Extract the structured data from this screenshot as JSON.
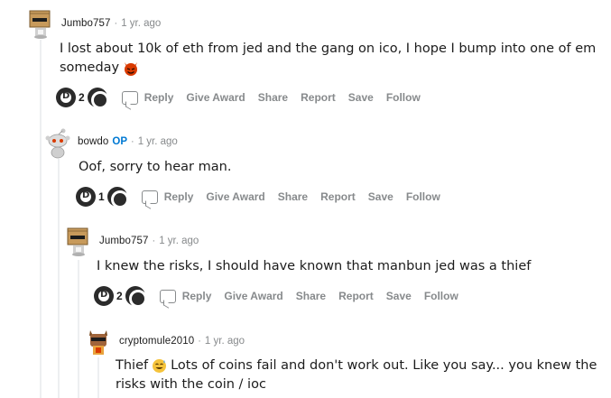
{
  "comments": [
    {
      "username": "Jumbo757",
      "op_badge": "",
      "separator": "·",
      "time": "1 yr. ago",
      "body_lines": [
        "I lost about 10k of eth from jed and the gang on ico, I hope I bump into one of em",
        "someday"
      ],
      "emoji": "devil-emoji",
      "score": "2",
      "actions": {
        "reply": "Reply",
        "give_award": "Give Award",
        "share": "Share",
        "report": "Report",
        "save": "Save",
        "follow": "Follow"
      }
    },
    {
      "username": "bowdo",
      "op_badge": "OP",
      "separator": "·",
      "time": "1 yr. ago",
      "body_lines": [
        "Oof, sorry to hear man."
      ],
      "score": "1",
      "actions": {
        "reply": "Reply",
        "give_award": "Give Award",
        "share": "Share",
        "report": "Report",
        "save": "Save",
        "follow": "Follow"
      }
    },
    {
      "username": "Jumbo757",
      "op_badge": "",
      "separator": "·",
      "time": "1 yr. ago",
      "body_lines": [
        "I knew the risks, I should have known that manbun jed was a thief"
      ],
      "score": "2",
      "actions": {
        "reply": "Reply",
        "give_award": "Give Award",
        "share": "Share",
        "report": "Report",
        "save": "Save",
        "follow": "Follow"
      }
    },
    {
      "username": "cryptomule2010",
      "op_badge": "",
      "separator": "·",
      "time": "1 yr. ago",
      "body_lines": [
        "Thief",
        "Lots of coins fail and don't work out. Like you say... you knew the",
        "risks with the coin / ioc"
      ],
      "emoji": "sweat-smile-emoji"
    }
  ],
  "colors": {
    "accent": "#0079d3",
    "muted": "#878a8c",
    "thread_line": "#edeff1",
    "devil": "#d93a00"
  }
}
